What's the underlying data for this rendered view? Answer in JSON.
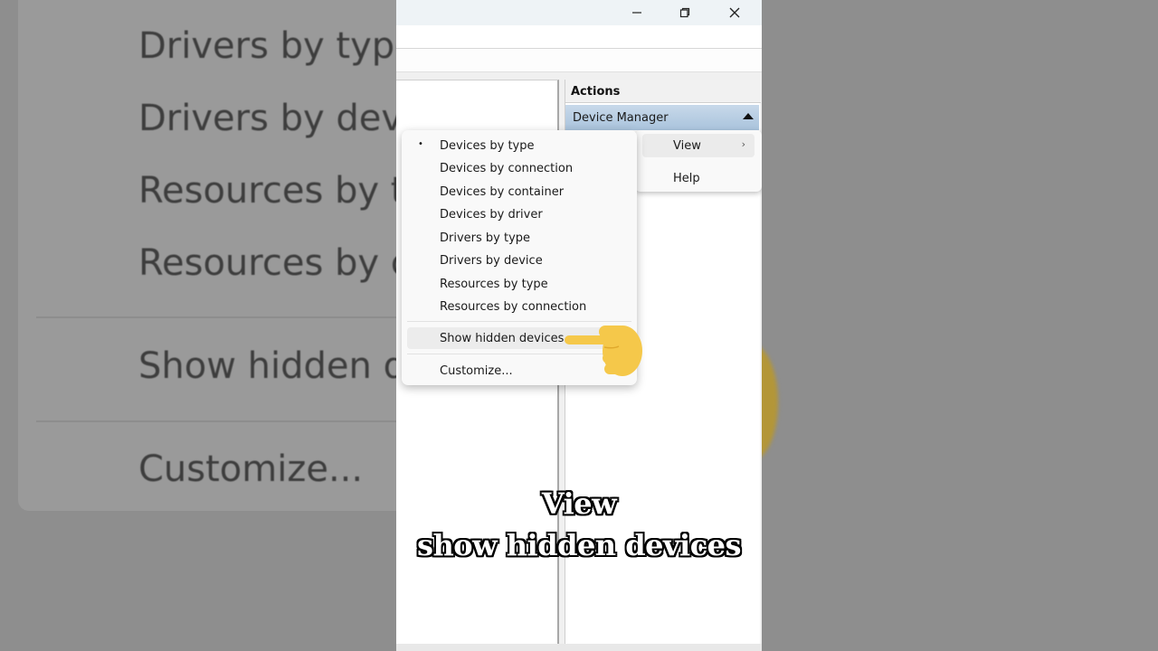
{
  "background_zoom": {
    "items": [
      "Drivers by type",
      "Drivers by device",
      "Resources by type",
      "Resources by connection",
      "Show hidden devices",
      "Customize..."
    ]
  },
  "window": {
    "minimize_icon": "minimize-icon",
    "restore_icon": "restore-icon",
    "close_icon": "close-icon"
  },
  "actions_pane": {
    "header": "Actions",
    "section": "Device Manager"
  },
  "small_menu": {
    "items": [
      {
        "label": "View",
        "has_submenu": true
      },
      {
        "label": "Help",
        "has_submenu": false
      }
    ]
  },
  "view_menu": {
    "items": [
      {
        "label": "Devices by type",
        "checked": true
      },
      {
        "label": "Devices by connection",
        "checked": false
      },
      {
        "label": "Devices by container",
        "checked": false
      },
      {
        "label": "Devices by driver",
        "checked": false
      },
      {
        "label": "Drivers by type",
        "checked": false
      },
      {
        "label": "Drivers by device",
        "checked": false
      },
      {
        "label": "Resources by type",
        "checked": false
      },
      {
        "label": "Resources by connection",
        "checked": false
      }
    ],
    "show_hidden": "Show hidden devices",
    "customize": "Customize...",
    "bullet": "•"
  },
  "caption": {
    "line1": "View",
    "line2": "show hidden devices"
  },
  "colors": {
    "hand": "#f5c84a",
    "actions_sub_bg": "#b7cde3"
  }
}
